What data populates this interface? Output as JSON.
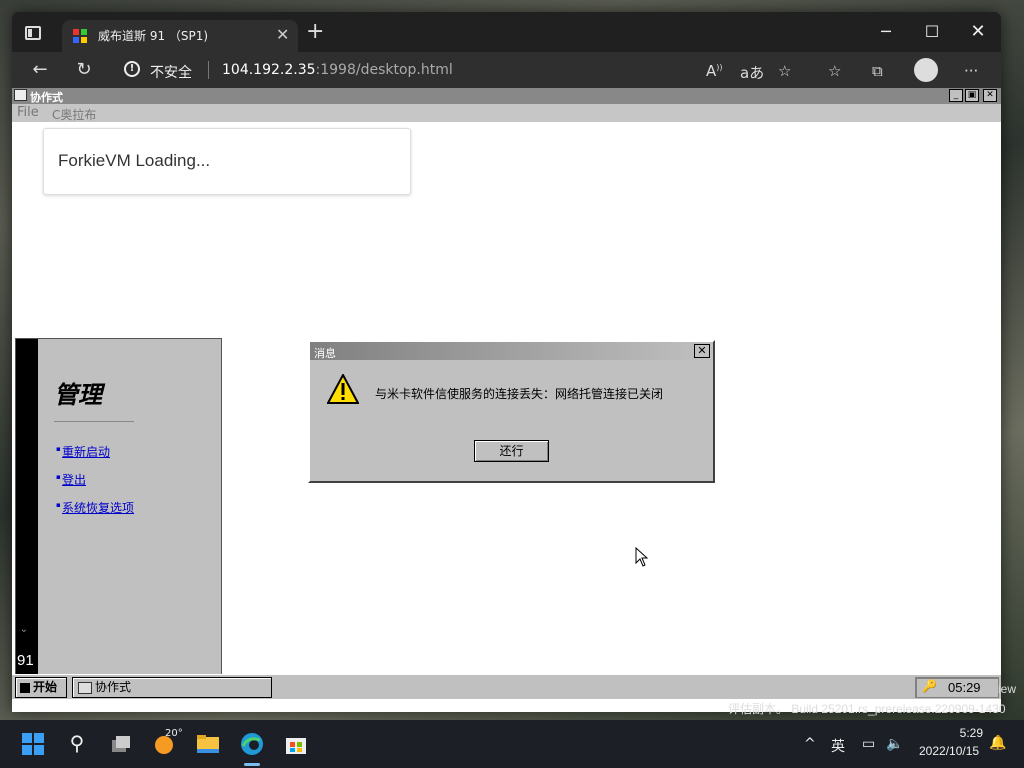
{
  "browser": {
    "tab_title": "威布道斯 91 （SP1)",
    "tab_close": "✕",
    "new_tab": "+",
    "insecure_label": "不安全",
    "url_host": "104.192.2.35",
    "url_path": ":1998/desktop.html",
    "icons": [
      "tab-actions-icon",
      "favicon-icon",
      "back-icon",
      "refresh-icon",
      "warning-icon",
      "read-aloud-icon",
      "translate-icon",
      "add-favorite-icon",
      "favorites-icon",
      "collections-icon",
      "profile-icon",
      "more-icon"
    ]
  },
  "app": {
    "title": "协作式",
    "menu": [
      "File",
      "C奥拉布"
    ],
    "loading_text": "ForkieVM Loading..."
  },
  "management": {
    "title": "管理",
    "links": [
      "重新启动",
      "登出",
      "系统恢复选项"
    ],
    "side_number": "91",
    "side_glyph": "ᵕ"
  },
  "dialog": {
    "title": "消息",
    "message": "与米卡软件信使服务的连接丢失：网络托管连接已关闭",
    "ok_label": "还行",
    "close": "✕"
  },
  "app_taskbar": {
    "start_label": "开始",
    "task_label": "协作式",
    "clock": "05:29"
  },
  "watermark": {
    "line1": "iew",
    "line2": "评估副本。 Build 25201.rs_prerelease.220909-1430"
  },
  "win_taskbar": {
    "weather_temp": "20°",
    "ime": "英",
    "time": "5:29",
    "date": "2022/10/15"
  }
}
